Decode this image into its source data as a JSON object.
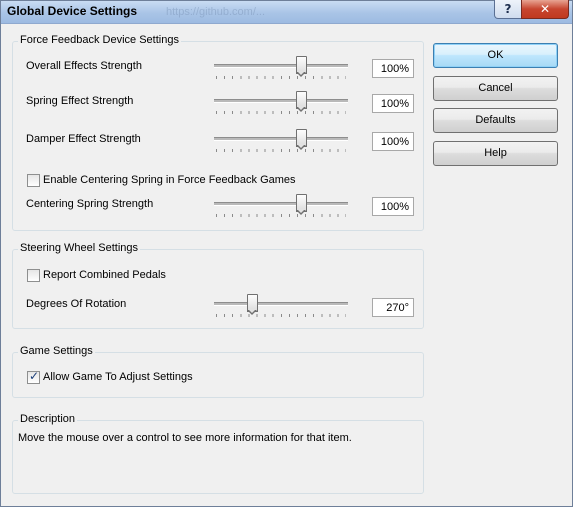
{
  "window": {
    "title": "Global Device Settings",
    "title_watermark": "https://github.com/...",
    "help_button": "?",
    "close_button": "✕"
  },
  "force_feedback": {
    "group_label": "Force Feedback Device Settings",
    "overall": {
      "label": "Overall Effects Strength",
      "value": "100%",
      "level": 0.65
    },
    "spring": {
      "label": "Spring Effect Strength",
      "value": "100%",
      "level": 0.65
    },
    "damper": {
      "label": "Damper Effect Strength",
      "value": "100%",
      "level": 0.65
    },
    "enable_centering": {
      "label": "Enable Centering Spring in Force Feedback Games",
      "checked": false
    },
    "centering_strength": {
      "label": "Centering Spring Strength",
      "value": "100%",
      "level": 0.65
    }
  },
  "steering": {
    "group_label": "Steering Wheel Settings",
    "report_combined": {
      "label": "Report Combined Pedals",
      "checked": false
    },
    "rotation": {
      "label": "Degrees Of Rotation",
      "value": "270°",
      "level": 0.28
    }
  },
  "game": {
    "group_label": "Game Settings",
    "allow_game": {
      "label": "Allow Game To Adjust Settings",
      "checked": true
    }
  },
  "description": {
    "group_label": "Description",
    "text": "Move the mouse over a control to see more information for that item."
  },
  "buttons": {
    "ok": "OK",
    "cancel": "Cancel",
    "defaults": "Defaults",
    "help": "Help"
  }
}
